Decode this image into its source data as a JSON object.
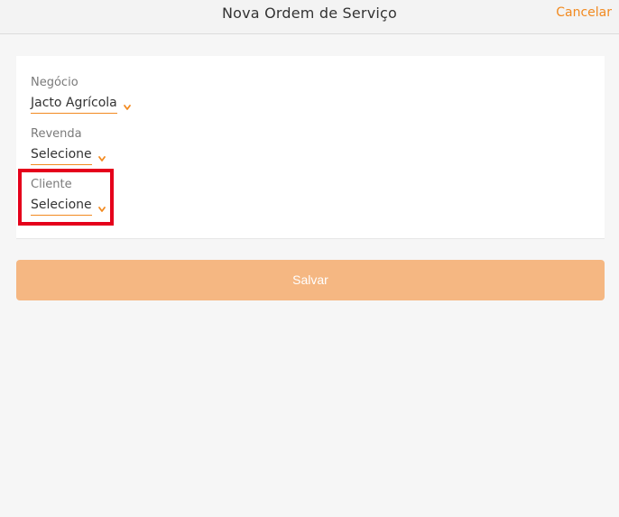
{
  "header": {
    "title": "Nova Ordem de Serviço",
    "cancel_label": "Cancelar"
  },
  "form": {
    "fields": [
      {
        "label": "Negócio",
        "value": "Jacto Agrícola"
      },
      {
        "label": "Revenda",
        "value": "Selecione"
      },
      {
        "label": "Cliente",
        "value": "Selecione"
      }
    ]
  },
  "save_label": "Salvar",
  "colors": {
    "accent": "#f28a20",
    "save_button": "#f5b782",
    "highlight": "#e5001b"
  },
  "icons": {
    "chevron": "chevron-down-icon"
  }
}
